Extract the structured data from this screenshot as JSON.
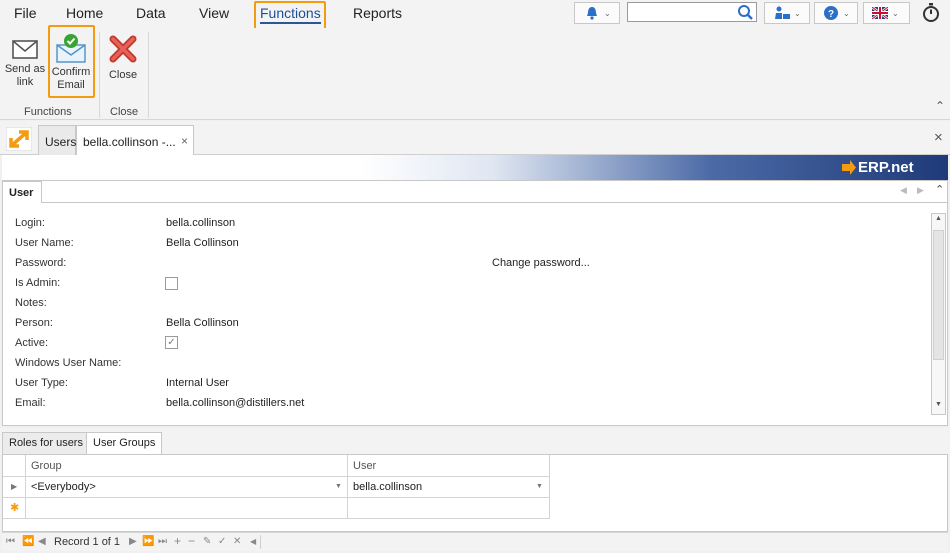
{
  "menu": {
    "file": "File",
    "home": "Home",
    "data": "Data",
    "view": "View",
    "functions": "Functions",
    "reports": "Reports"
  },
  "toolbar": {
    "search_value": ""
  },
  "ribbon": {
    "send_as_link": [
      "Send as",
      "link"
    ],
    "confirm_email": [
      "Confirm",
      "Email"
    ],
    "close": "Close",
    "group_functions": "Functions",
    "group_close": "Close"
  },
  "tabs": {
    "users": "Users",
    "current": "bella.collinson -..."
  },
  "brand": {
    "logo": "ERP.net"
  },
  "panel": {
    "tab": "User",
    "fields": [
      {
        "label": "Login:",
        "value": "bella.collinson"
      },
      {
        "label": "User Name:",
        "value": "Bella Collinson"
      },
      {
        "label": "Password:",
        "value": ""
      },
      {
        "label": "Is Admin:",
        "value": ""
      },
      {
        "label": "Notes:",
        "value": ""
      },
      {
        "label": "Person:",
        "value": "Bella Collinson"
      },
      {
        "label": "Active:",
        "value": ""
      },
      {
        "label": "Windows User Name:",
        "value": ""
      },
      {
        "label": "User Type:",
        "value": "Internal User"
      },
      {
        "label": "Email:",
        "value": "bella.collinson@distillers.net"
      }
    ],
    "change_password": "Change password...",
    "is_admin_checked": false,
    "active_checked": true
  },
  "bottom_tabs": {
    "roles": "Roles for users",
    "groups": "User Groups"
  },
  "grid": {
    "columns": [
      "Group",
      "User"
    ],
    "rows": [
      {
        "group": "<Everybody>",
        "user": "bella.collinson"
      }
    ]
  },
  "navigator": {
    "record_text": "Record 1 of 1"
  },
  "colors": {
    "accent": "#f39c12",
    "active_menu": "#2b5797"
  }
}
